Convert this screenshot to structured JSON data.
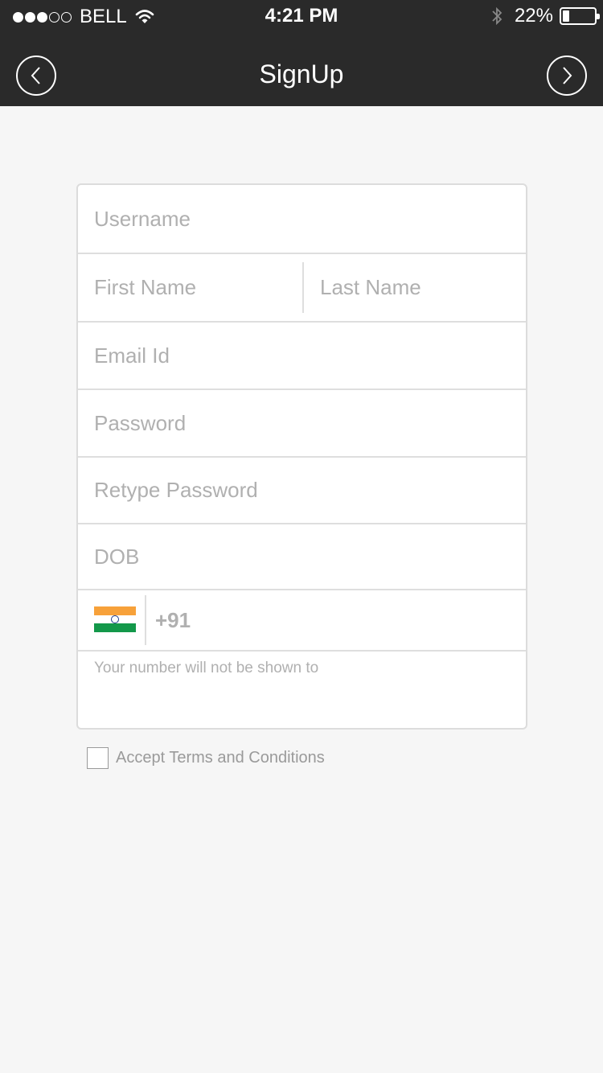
{
  "status_bar": {
    "carrier": "BELL",
    "time": "4:21 PM",
    "battery_percent": "22%",
    "battery_level": 0.22,
    "signal_bars_filled": 3,
    "signal_bars_total": 5,
    "icons": [
      "wifi-icon",
      "bluetooth-icon",
      "battery-icon"
    ]
  },
  "nav": {
    "title": "SignUp",
    "back_icon": "chevron-left-icon",
    "next_icon": "chevron-right-icon"
  },
  "form": {
    "username": {
      "placeholder": "Username",
      "value": ""
    },
    "first_name": {
      "placeholder": "First Name",
      "value": ""
    },
    "last_name": {
      "placeholder": "Last Name",
      "value": ""
    },
    "email": {
      "placeholder": "Email Id",
      "value": ""
    },
    "password": {
      "placeholder": "Password",
      "value": ""
    },
    "retype_password": {
      "placeholder": "Retype Password",
      "value": ""
    },
    "dob": {
      "placeholder": "DOB",
      "value": ""
    },
    "phone": {
      "country_flag_icon": "india-flag-icon",
      "country_code": "+91",
      "value": ""
    },
    "note": "Your number will not be shown to"
  },
  "terms": {
    "label": "Accept Terms and Conditions",
    "checked": false
  },
  "colors": {
    "topbar": "#2a2a2a",
    "background": "#f6f6f6",
    "placeholder": "#b0b0b0",
    "flag_saffron": "#f7a13a",
    "flag_white": "#ffffff",
    "flag_green": "#13984a"
  }
}
